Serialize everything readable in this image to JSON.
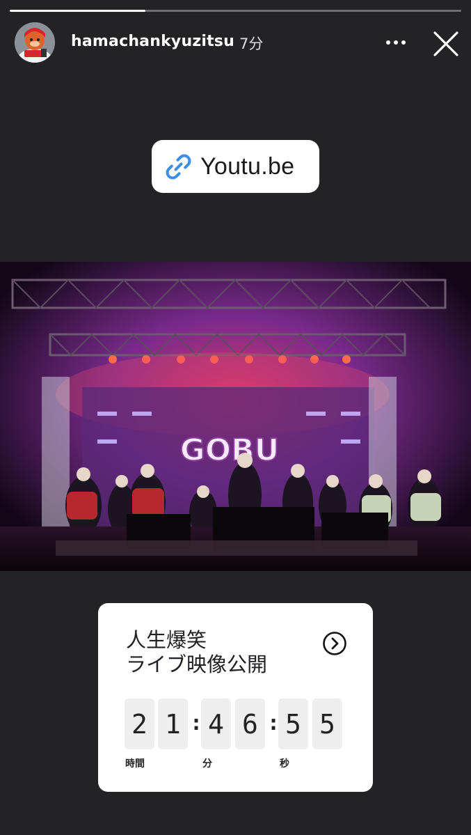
{
  "story": {
    "progress_fraction": 0.3,
    "username": "hamachankyuzitsu",
    "timestamp": "7分",
    "more_icon": "more-horizontal-icon",
    "close_icon": "close-icon"
  },
  "link_sticker": {
    "icon": "link-icon",
    "text": "Youtu.be"
  },
  "countdown": {
    "title_line1": "人生爆笑",
    "title_line2": "ライブ映像公開",
    "arrow_icon": "chevron-right-circle-icon",
    "hours": [
      "2",
      "1"
    ],
    "minutes": [
      "4",
      "6"
    ],
    "seconds": [
      "5",
      "5"
    ],
    "colon": ":",
    "hours_label": "時間",
    "minutes_label": "分",
    "seconds_label": "秒"
  },
  "colors": {
    "background": "#232325",
    "link_icon_blue": "#3d8fe6"
  }
}
